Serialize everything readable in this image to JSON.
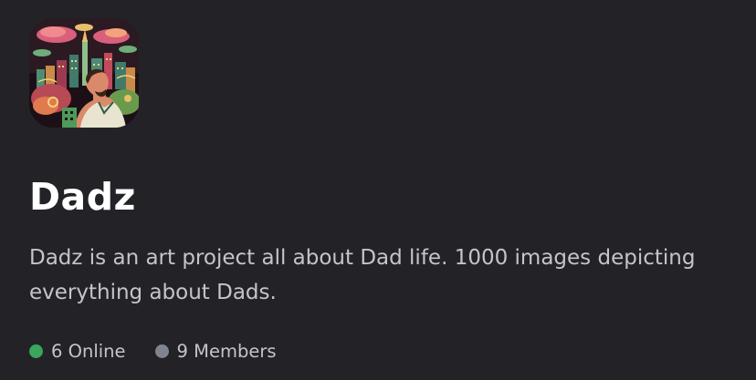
{
  "server": {
    "name": "Dadz",
    "description": "Dadz is an art project all about Dad life. 1000 images depicting everything about Dads.",
    "icon": "server-avatar-image"
  },
  "stats": {
    "online_count": "6",
    "online_label": "Online",
    "online_color": "#3ba55d",
    "members_count": "9",
    "members_label": "Members",
    "members_color": "#80848e"
  },
  "colors": {
    "background": "#232327",
    "title": "#ffffff",
    "body_text": "#c4c5ca"
  }
}
